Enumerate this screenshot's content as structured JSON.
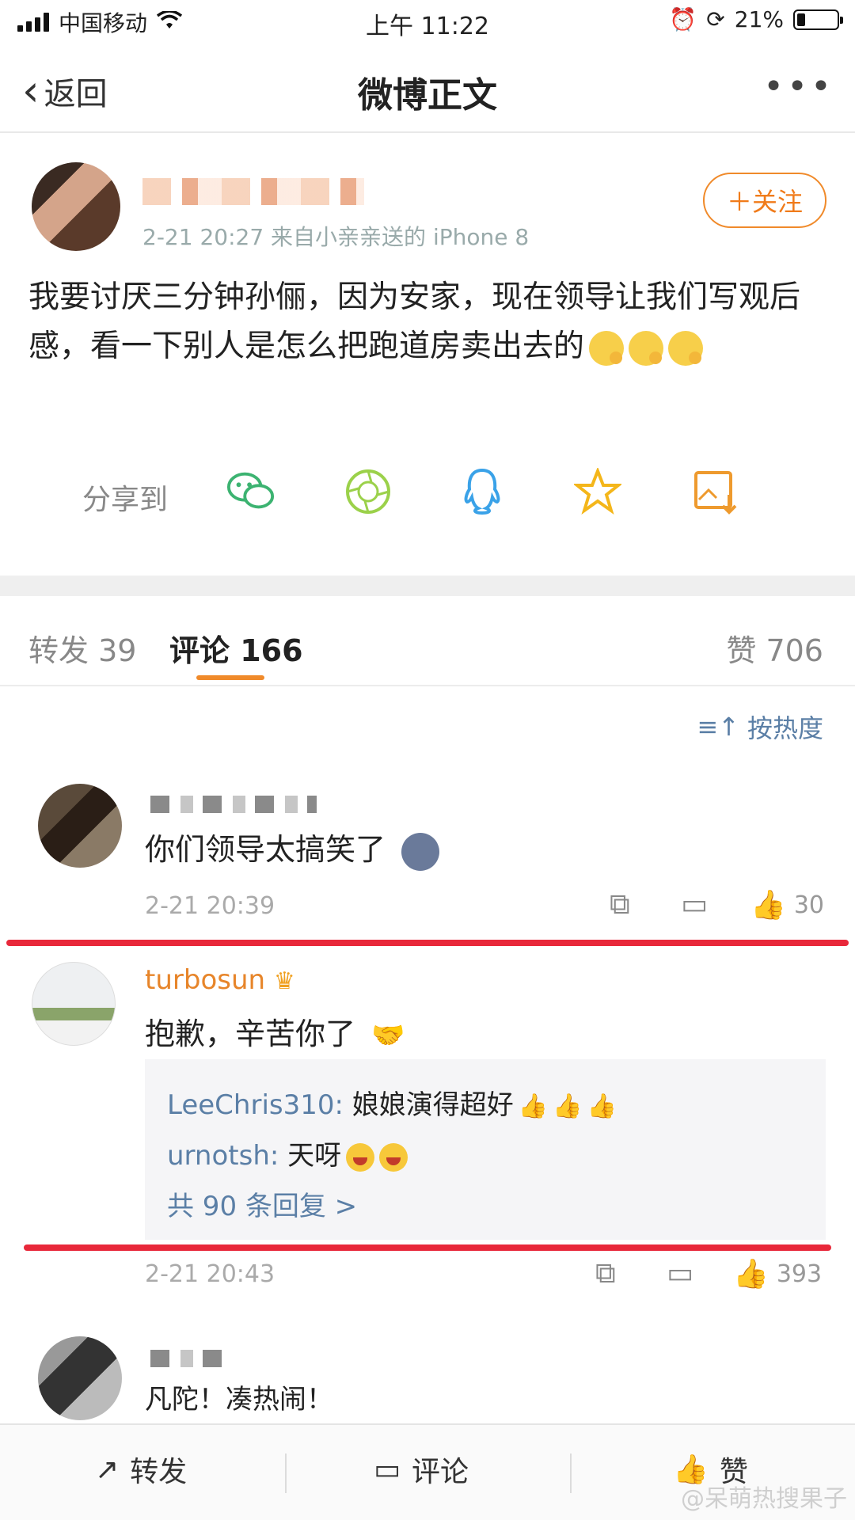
{
  "status": {
    "carrier": "中国移动",
    "time": "上午 11:22",
    "battery": "21%"
  },
  "nav": {
    "back": "返回",
    "title": "微博正文"
  },
  "post": {
    "meta": "2-21 20:27 来自小亲亲送的 iPhone 8",
    "follow": "＋关注",
    "text": "我要讨厌三分钟孙俪，因为安家，现在领导让我们写观后感，看一下别人是怎么把跑道房卖出去的"
  },
  "share": {
    "label": "分享到",
    "icons": [
      "wechat-icon",
      "moments-icon",
      "qq-icon",
      "qzone-icon",
      "save-image-icon"
    ]
  },
  "tabs": {
    "repost": "转发 39",
    "comment": "评论 166",
    "like": "赞 706"
  },
  "sort": "按热度",
  "comments": [
    {
      "text": "你们领导太搞笑了",
      "time": "2-21 20:39",
      "likes": "30"
    },
    {
      "name": "turbosun",
      "text": "抱歉，辛苦你了",
      "replies": [
        {
          "user": "LeeChris310:",
          "text": " 娘娘演得超好"
        },
        {
          "user": "urnotsh:",
          "text": " 天呀"
        }
      ],
      "more": "共 90 条回复 >",
      "time": "2-21 20:43",
      "likes": "393"
    },
    {
      "text": "凡陀！凑热闹！"
    }
  ],
  "toolbar": {
    "repost": "转发",
    "comment": "评论",
    "like": "赞"
  },
  "watermark": "@呆萌热搜果子",
  "colors": {
    "accent": "#f08a2a",
    "link": "#5b7fa6",
    "highlight": "#e8283a"
  }
}
